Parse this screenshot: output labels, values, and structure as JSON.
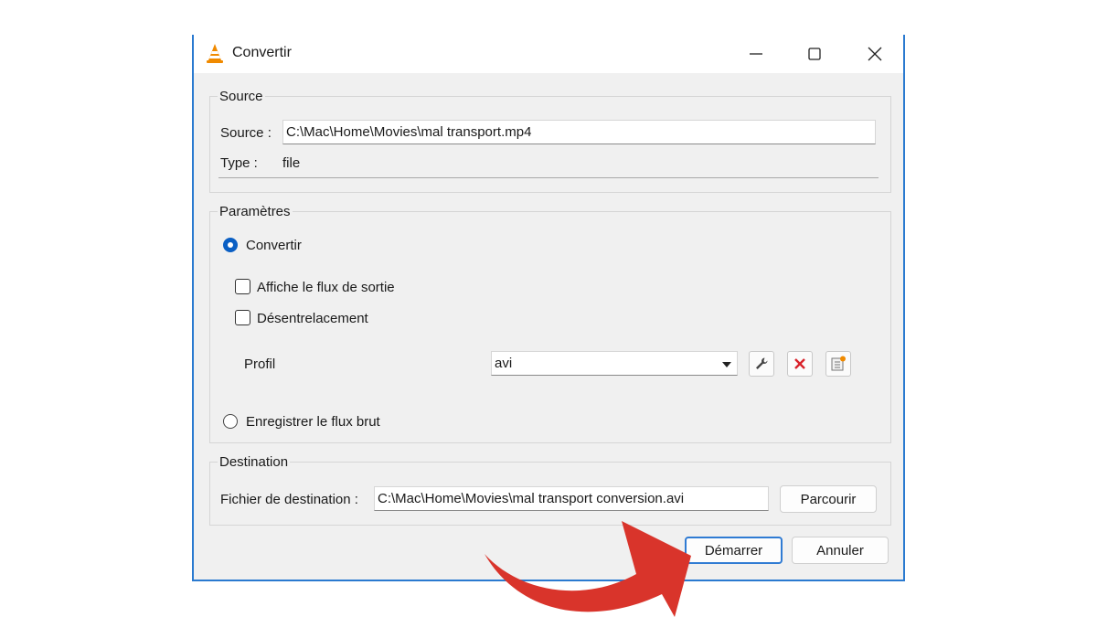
{
  "window": {
    "title": "Convertir"
  },
  "source_group": {
    "title": "Source",
    "source_label": "Source :",
    "source_value": "C:\\Mac\\Home\\Movies\\mal transport.mp4",
    "type_label": "Type :",
    "type_value": "file"
  },
  "params_group": {
    "title": "Paramètres",
    "convert_label": "Convertir",
    "show_output_label": "Affiche le flux de sortie",
    "deinterlace_label": "Désentrelacement",
    "profile_label": "Profil",
    "profile_value": "avi",
    "raw_dump_label": "Enregistrer le flux brut"
  },
  "dest_group": {
    "title": "Destination",
    "dest_label": "Fichier de destination :",
    "dest_value": "C:\\Mac\\Home\\Movies\\mal transport conversion.avi",
    "browse_label": "Parcourir"
  },
  "buttons": {
    "start_label": "Démarrer",
    "cancel_label": "Annuler"
  },
  "icons": {
    "app": "vlc-cone-icon",
    "minimize": "minimize-icon",
    "maximize": "maximize-icon",
    "close": "close-icon",
    "edit_profile": "wrench-icon",
    "delete_profile": "red-x-icon",
    "new_profile": "new-profile-icon",
    "annotation": "red-curved-arrow-icon"
  },
  "colors": {
    "accent": "#0a5fc4",
    "annotation_arrow": "#d9342b",
    "window_border": "#2a7ad0"
  }
}
